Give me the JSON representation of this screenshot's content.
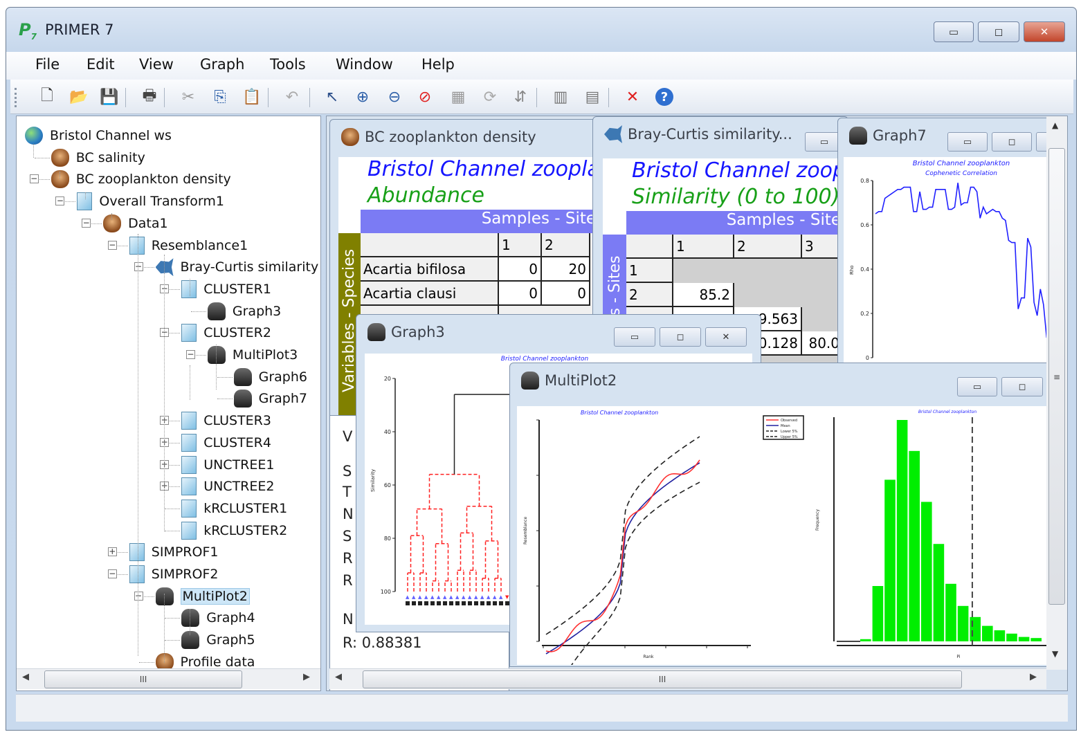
{
  "app": {
    "title": "PRIMER 7",
    "logo": "P7"
  },
  "window_buttons": {
    "minimize": "▭",
    "maximize": "◻",
    "close": "✕"
  },
  "menu": [
    "File",
    "Edit",
    "View",
    "Graph",
    "Tools",
    "Window",
    "Help"
  ],
  "toolbar": [
    "new-icon",
    "open-icon",
    "save-icon",
    "print-icon",
    "cut-icon",
    "copy-icon",
    "paste-icon",
    "undo-icon",
    "pointer-icon",
    "zoom-in-icon",
    "zoom-out-icon",
    "zoom-reset-icon",
    "select-area-icon",
    "rotate-icon",
    "flip-icon",
    "sample-stats-icon",
    "variable-stats-icon",
    "delete-icon",
    "help-icon"
  ],
  "tree": [
    {
      "label": "Bristol Channel ws",
      "level": 0,
      "icon": "globe",
      "exp": ""
    },
    {
      "label": "BC salinity",
      "level": 1,
      "icon": "bug",
      "exp": ""
    },
    {
      "label": "BC zooplankton density",
      "level": 1,
      "icon": "bug",
      "exp": "-"
    },
    {
      "label": "Overall Transform1",
      "level": 2,
      "icon": "sheet",
      "exp": "-"
    },
    {
      "label": "Data1",
      "level": 3,
      "icon": "bug",
      "exp": "-"
    },
    {
      "label": "Resemblance1",
      "level": 4,
      "icon": "sheet",
      "exp": "-"
    },
    {
      "label": "Bray-Curtis similarity",
      "level": 5,
      "icon": "fish",
      "exp": "-"
    },
    {
      "label": "CLUSTER1",
      "level": 6,
      "icon": "sheet",
      "exp": "-"
    },
    {
      "label": "Graph3",
      "level": 7,
      "icon": "graph",
      "exp": ""
    },
    {
      "label": "CLUSTER2",
      "level": 6,
      "icon": "sheet",
      "exp": "-"
    },
    {
      "label": "MultiPlot3",
      "level": 7,
      "icon": "graph",
      "exp": "-"
    },
    {
      "label": "Graph6",
      "level": 8,
      "icon": "graph",
      "exp": ""
    },
    {
      "label": "Graph7",
      "level": 8,
      "icon": "graph",
      "exp": ""
    },
    {
      "label": "CLUSTER3",
      "level": 6,
      "icon": "sheet",
      "exp": "+"
    },
    {
      "label": "CLUSTER4",
      "level": 6,
      "icon": "sheet",
      "exp": "+"
    },
    {
      "label": "UNCTREE1",
      "level": 6,
      "icon": "sheet",
      "exp": "+"
    },
    {
      "label": "UNCTREE2",
      "level": 6,
      "icon": "sheet",
      "exp": "+"
    },
    {
      "label": "kRCLUSTER1",
      "level": 6,
      "icon": "sheet",
      "exp": ""
    },
    {
      "label": "kRCLUSTER2",
      "level": 6,
      "icon": "sheet",
      "exp": ""
    },
    {
      "label": "SIMPROF1",
      "level": 4,
      "icon": "sheet",
      "exp": "+"
    },
    {
      "label": "SIMPROF2",
      "level": 4,
      "icon": "sheet",
      "exp": "-"
    },
    {
      "label": "MultiPlot2",
      "level": 5,
      "icon": "graph",
      "exp": "-",
      "selected": true
    },
    {
      "label": "Graph4",
      "level": 6,
      "icon": "graph",
      "exp": ""
    },
    {
      "label": "Graph5",
      "level": 6,
      "icon": "graph",
      "exp": ""
    },
    {
      "label": "Profile data",
      "level": 5,
      "icon": "bug",
      "exp": ""
    }
  ],
  "scroll": {
    "thumb": "III",
    "left": "◀",
    "right": "▶",
    "up": "▲",
    "down": "▼",
    "grip": "≡"
  },
  "bc_density": {
    "title": "BC zooplankton density",
    "heading": "Bristol Channel zooplankton",
    "subheading": "Abundance",
    "col_axis": "Samples - Sites",
    "row_axis": "Variables - Species",
    "columns": [
      "1",
      "2"
    ],
    "rows": [
      {
        "name": "Acartia bifilosa",
        "values": [
          "0",
          "20"
        ]
      },
      {
        "name": "Acartia clausi",
        "values": [
          "0",
          "0"
        ]
      }
    ]
  },
  "bray": {
    "title": "Bray-Curtis similarity...",
    "heading": "Bristol Channel zooplankton",
    "subheading": "Similarity (0 to 100)",
    "col_axis": "Samples - Sites",
    "row_axis": "Samples - Sites",
    "columns": [
      "1",
      "2",
      "3"
    ],
    "rows": [
      {
        "name": "1",
        "values": [
          "",
          "",
          ""
        ]
      },
      {
        "name": "2",
        "values": [
          "85.2",
          "",
          ""
        ]
      },
      {
        "name": "",
        "values": [
          "",
          "9.563",
          ""
        ]
      },
      {
        "name": "",
        "values": [
          "",
          "0.128",
          "80.0"
        ]
      }
    ]
  },
  "results": {
    "letters": [
      "V",
      "S",
      "T",
      "N",
      "S",
      "R",
      "R",
      "N"
    ],
    "r_value": "R: 0.88381"
  },
  "graph7": {
    "title": "Graph7",
    "chart_title": "Bristol Channel zooplankton",
    "chart_subtitle": "Cophenetic Correlation",
    "ylabel": "Rho",
    "yticks": [
      "0",
      "0.2",
      "0.4",
      "0.6",
      "0.8"
    ],
    "ylim": [
      0,
      0.8
    ],
    "values": [
      0.65,
      0.66,
      0.66,
      0.72,
      0.73,
      0.74,
      0.75,
      0.76,
      0.76,
      0.77,
      0.77,
      0.77,
      0.66,
      0.66,
      0.75,
      0.67,
      0.67,
      0.68,
      0.68,
      0.76,
      0.76,
      0.76,
      0.76,
      0.67,
      0.67,
      0.68,
      0.79,
      0.69,
      0.7,
      0.7,
      0.77,
      0.77,
      0.75,
      0.63,
      0.68,
      0.65,
      0.66,
      0.67,
      0.66,
      0.66,
      0.63,
      0.62,
      0.53,
      0.52,
      0.52,
      0.22,
      0.27,
      0.27,
      0.54,
      0.5,
      0.25,
      0.19,
      0.31,
      0.24,
      0.09,
      0.22
    ]
  },
  "graph3": {
    "title": "Graph3",
    "chart_title": "Bristol Channel zooplankton",
    "ylabel": "Similarity",
    "yticks": [
      "20",
      "40",
      "60",
      "80",
      "100"
    ],
    "ylim": [
      20,
      100
    ]
  },
  "multiplot2": {
    "title": "MultiPlot2",
    "left": {
      "chart_title": "Bristol Channel zooplankton",
      "xlabel": "Rank",
      "ylabel": "Resemblance",
      "legend": [
        "Observed",
        "Mean",
        "Lower 5%",
        "Upper 5%"
      ],
      "colors": [
        "#ff3030",
        "#2020a0",
        "#222222",
        "#222222"
      ]
    },
    "right": {
      "chart_title": "Bristol Channel zooplankton",
      "xlabel": "Pi",
      "ylabel": "Frequency",
      "bar_color": "#00ee00",
      "values": [
        0.01,
        0.25,
        0.73,
        1.0,
        0.86,
        0.63,
        0.44,
        0.26,
        0.16,
        0.11,
        0.07,
        0.05,
        0.035,
        0.02,
        0.015
      ],
      "observed_index": 9.2
    }
  }
}
